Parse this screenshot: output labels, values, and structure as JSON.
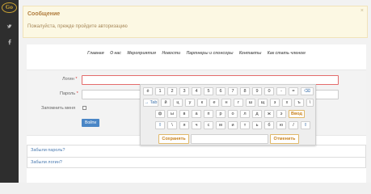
{
  "logo": {
    "text": "Go"
  },
  "social": [
    "twitter-icon",
    "facebook-icon"
  ],
  "alert": {
    "title": "Сообщение",
    "text": "Пожалуйста, прежде пройдите авторизацию",
    "close": "×"
  },
  "nav": [
    "Главная",
    "О нас",
    "Мероприятия",
    "Новости",
    "Партнеры и спонсоры",
    "Контакты",
    "Как стать членом"
  ],
  "form": {
    "login_label": "Логин",
    "password_label": "Пароль",
    "required_mark": "*",
    "remember_label": "Запомнить меня",
    "login_button": "Войти",
    "login_value": "",
    "password_value": ""
  },
  "links": [
    "Забыли пароль?",
    "Забыли логин?"
  ],
  "keyboard": {
    "row1": [
      "ё",
      "1",
      "2",
      "3",
      "4",
      "5",
      "6",
      "7",
      "8",
      "9",
      "0",
      "-",
      "=",
      "⌫"
    ],
    "row2": [
      "→ Tab",
      "й",
      "ц",
      "у",
      "к",
      "е",
      "н",
      "г",
      "ш",
      "щ",
      "з",
      "х",
      "ъ",
      "\\"
    ],
    "row3": [
      "ф",
      "ы",
      "в",
      "а",
      "п",
      "р",
      "о",
      "л",
      "д",
      "ж",
      "э",
      "Ввод"
    ],
    "row4": [
      "⇧",
      "\\",
      "я",
      "ч",
      "с",
      "м",
      "и",
      "т",
      "ь",
      "б",
      "ю",
      "/",
      "⇧"
    ],
    "save": "Сохранять",
    "cancel": "Отменить"
  }
}
